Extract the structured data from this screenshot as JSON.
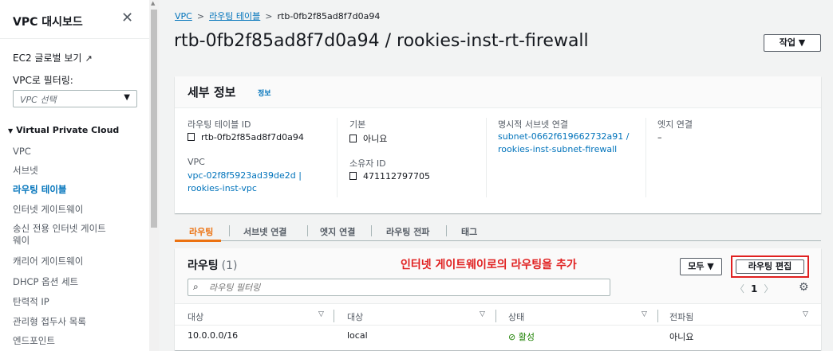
{
  "sidebar": {
    "title": "VPC 대시보드",
    "close": "✕",
    "ec2_link": "EC2 글로벌 보기",
    "ec2_ext": "↗",
    "filter_label": "VPC로 필터링:",
    "filter_placeholder": "VPC 선택",
    "group": "Virtual Private Cloud",
    "items": [
      {
        "label": "VPC"
      },
      {
        "label": "서브넷"
      },
      {
        "label": "라우팅 테이블"
      },
      {
        "label": "인터넷 게이트웨이"
      },
      {
        "label": "송신 전용 인터넷 게이트"
      },
      {
        "label": "웨이"
      },
      {
        "label": "캐리어 게이트웨이"
      },
      {
        "label": "DHCP 옵션 세트"
      },
      {
        "label": "탄력적 IP"
      },
      {
        "label": "관리형 접두사 목록"
      },
      {
        "label": "엔드포인트"
      }
    ]
  },
  "breadcrumb": {
    "vpc": "VPC",
    "route_tables": "라우팅 테이블",
    "current": "rtb-0fb2f85ad8f7d0a94",
    "sep": ">"
  },
  "page": {
    "title": "rtb-0fb2f85ad8f7d0a94 / rookies-inst-rt-firewall",
    "action": "작업 ▼"
  },
  "details": {
    "title": "세부 정보",
    "info": "정보",
    "rt_id_label": "라우팅 테이블 ID",
    "rt_id_value": "rtb-0fb2f85ad8f7d0a94",
    "vpc_label": "VPC",
    "vpc_value_1": "vpc-02f8f5923ad39de2d |",
    "vpc_value_2": "rookies-inst-vpc",
    "main_label": "기본",
    "main_value": "아니요",
    "owner_label": "소유자 ID",
    "owner_value": "471112797705",
    "explicit_label": "명시적 서브넷 연결",
    "explicit_value_1": "subnet-0662f619662732a91 /",
    "explicit_value_2": "rookies-inst-subnet-firewall",
    "edge_label": "엣지 연결",
    "edge_value": "–"
  },
  "tabs": [
    "라우팅",
    "서브넷 연결",
    "엣지 연결",
    "라우팅 전파",
    "태그"
  ],
  "routes": {
    "title": "라우팅",
    "count": "(1)",
    "annotation": "인터넷 게이트웨이로의 라우팅을 추가",
    "filter_select": "모두 ▼",
    "edit_button": "라우팅 편집",
    "search_placeholder": "라우팅 필터링",
    "page": "1",
    "prev": "〈",
    "next": "〉",
    "columns": [
      "대상",
      "대상",
      "상태",
      "전파됨"
    ],
    "rows": [
      {
        "destination": "10.0.0.0/16",
        "target": "local",
        "status": "⊘ 활성",
        "propagated": "아니요"
      }
    ]
  },
  "colors": {
    "accent": "#ec7211",
    "link": "#0073bb",
    "annotation": "#e02020",
    "active_status": "#1d8102"
  }
}
